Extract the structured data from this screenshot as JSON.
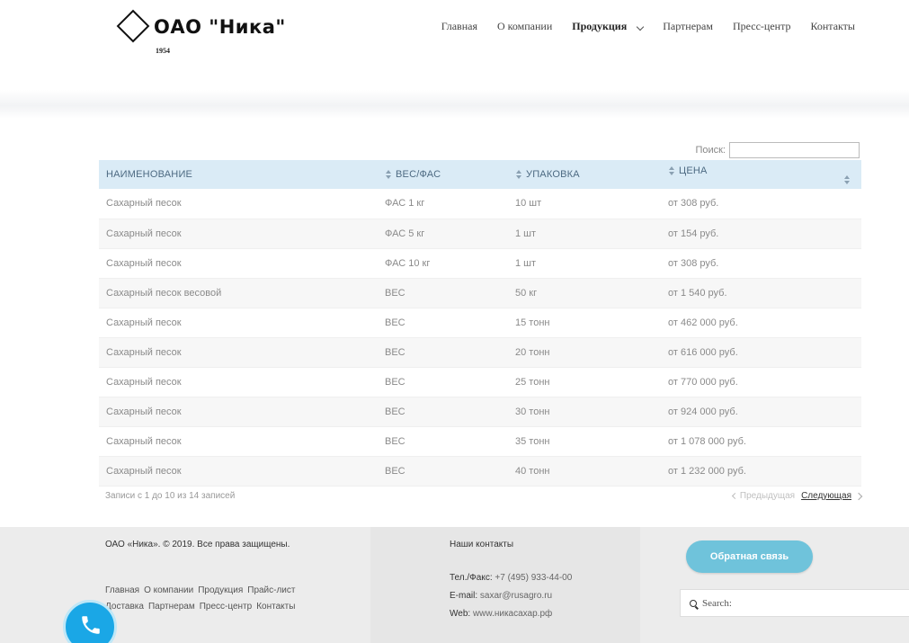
{
  "header": {
    "logo_text": "ОАО \"Ника\"",
    "logo_year": "1954",
    "nav": [
      {
        "label": "Главная"
      },
      {
        "label": "О компании"
      },
      {
        "label": "Продукция"
      },
      {
        "label": "Партнерам"
      },
      {
        "label": "Пресс-центр"
      },
      {
        "label": "Контакты"
      }
    ]
  },
  "search": {
    "label": "Поиск:",
    "value": ""
  },
  "table": {
    "columns": [
      "НАИМЕНОВАНИЕ",
      "ВЕС/ФАС",
      "УПАКОВКА",
      "ЦЕНА"
    ],
    "rows": [
      [
        "Сахарный песок",
        "ФАС 1 кг",
        "10 шт",
        "от 308 руб."
      ],
      [
        "Сахарный песок",
        "ФАС 5 кг",
        "1 шт",
        "от 154 руб."
      ],
      [
        "Сахарный песок",
        "ФАС 10 кг",
        "1 шт",
        "от 308 руб."
      ],
      [
        "Сахарный песок весовой",
        "ВЕС",
        "50 кг",
        "от 1 540 руб."
      ],
      [
        "Сахарный песок",
        "ВЕС",
        "15 тонн",
        "от 462 000 руб."
      ],
      [
        "Сахарный песок",
        "ВЕС",
        "20 тонн",
        "от 616 000 руб."
      ],
      [
        "Сахарный песок",
        "ВЕС",
        "25 тонн",
        "от 770 000 руб."
      ],
      [
        "Сахарный песок",
        "ВЕС",
        "30 тонн",
        "от 924 000 руб."
      ],
      [
        "Сахарный песок",
        "ВЕС",
        "35 тонн",
        "от 1 078 000 руб."
      ],
      [
        "Сахарный песок",
        "ВЕС",
        "40 тонн",
        "от 1 232 000 руб."
      ]
    ]
  },
  "info": "Записи с 1 до 10 из 14 записей",
  "pager": {
    "prev": "Предыдущая",
    "next": "Следующая"
  },
  "footer": {
    "copyright": "ОАО «Ника». © 2019. Все права защищены.",
    "links_line1": [
      "Главная",
      "О компании",
      "Продукция",
      "Прайс-лист"
    ],
    "links_line2": [
      "Доставка",
      "Партнерам",
      "Пресс-центр",
      "Контакты"
    ],
    "contacts_title": "Наши контакты",
    "phone_label": "Тел./Факс:",
    "phone": "+7 (495) 933-44-00",
    "email_label": "E-mail:",
    "email": "saxar@rusagro.ru",
    "web_label": "Web:",
    "web": "www.никасахар.рф",
    "feedback_button": "Обратная связь",
    "search_placeholder": "Search:"
  },
  "colors": {
    "table_header_bg": "#daebf6",
    "feedback_button": "#6fc3db",
    "phone_button": "#1aa7e6"
  },
  "icons": [
    "diamond-logo-icon",
    "chevron-down-icon",
    "sort-icon",
    "chevron-left-icon",
    "chevron-right-icon",
    "search-icon",
    "phone-icon"
  ]
}
